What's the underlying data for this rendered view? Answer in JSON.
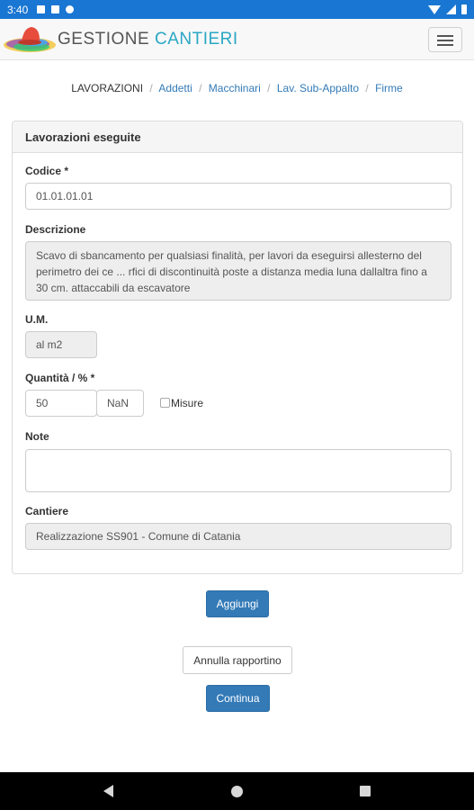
{
  "status_bar": {
    "time": "3:40"
  },
  "header": {
    "brand_part1": "GESTIONE",
    "brand_part2": "CANTIERI"
  },
  "breadcrumb": {
    "active": "LAVORAZIONI",
    "links": [
      "Addetti",
      "Macchinari",
      "Lav. Sub-Appalto",
      "Firme"
    ],
    "separator": "/"
  },
  "form": {
    "title": "Lavorazioni eseguite",
    "codice_label": "Codice *",
    "codice_value": "01.01.01.01",
    "descrizione_label": "Descrizione",
    "descrizione_value": "Scavo di sbancamento per qualsiasi finalità, per lavori da eseguirsi allesterno del perimetro dei ce ... rfici di discontinuità poste a distanza media luna dallaltra fino a 30 cm. attaccabili da escavatore",
    "um_label": "U.M.",
    "um_value": "al m2",
    "quantita_label": "Quantità / % *",
    "quantita_value": "50",
    "percent_value": "NaN",
    "misure_label": "Misure",
    "misure_checked": false,
    "note_label": "Note",
    "note_value": "",
    "cantiere_label": "Cantiere",
    "cantiere_value": "Realizzazione SS901 - Comune di Catania"
  },
  "actions": {
    "aggiungi": "Aggiungi",
    "annulla": "Annulla rapportino",
    "continua": "Continua"
  },
  "colors": {
    "status_bar": "#1976d2",
    "primary": "#337ab7",
    "brand_accent": "#2aa7c4"
  }
}
